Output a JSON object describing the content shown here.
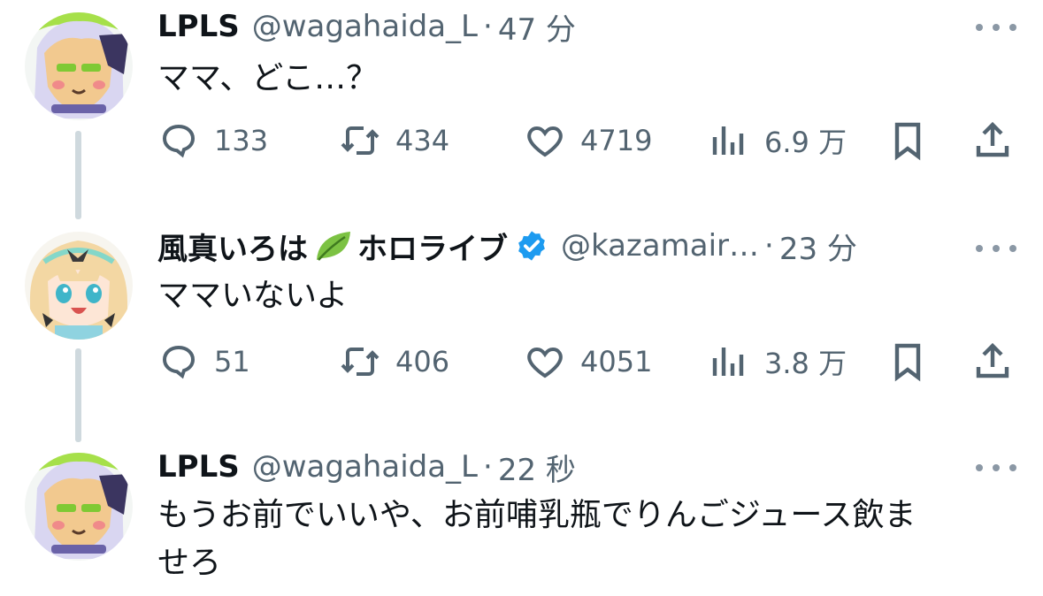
{
  "tweets": [
    {
      "name": "LPLS",
      "handle": "@wagahaida_L",
      "sep": "·",
      "time": "47 分",
      "text": "ママ、どこ…？",
      "replies": "133",
      "retweets": "434",
      "likes": "4719",
      "views": "6.9 万"
    },
    {
      "name": "風真いろは",
      "name_suffix": "ホロライブ",
      "handle": "@kazamair…",
      "sep": "·",
      "time": "23 分",
      "text": "ママいないよ",
      "replies": "51",
      "retweets": "406",
      "likes": "4051",
      "views": "3.8 万"
    },
    {
      "name": "LPLS",
      "handle": "@wagahaida_L",
      "sep": "·",
      "time": "22 秒",
      "text_line1": "もうお前でいいや、お前哺乳瓶でりんごジュース飲ま",
      "text_line2": "せろ"
    }
  ],
  "icons": {
    "reply": "comment-bubble-icon",
    "retweet": "retweet-icon",
    "like": "heart-icon",
    "views": "bar-chart-icon",
    "bookmark": "bookmark-icon",
    "share": "share-upload-icon",
    "more": "ellipsis-icon",
    "verified": "verified-badge-icon",
    "leaf": "leaf-emoji-icon"
  },
  "colors": {
    "text": "#0f1419",
    "secondary": "#536471",
    "thread_line": "#cfd9de",
    "verified": "#1d9bf0"
  }
}
